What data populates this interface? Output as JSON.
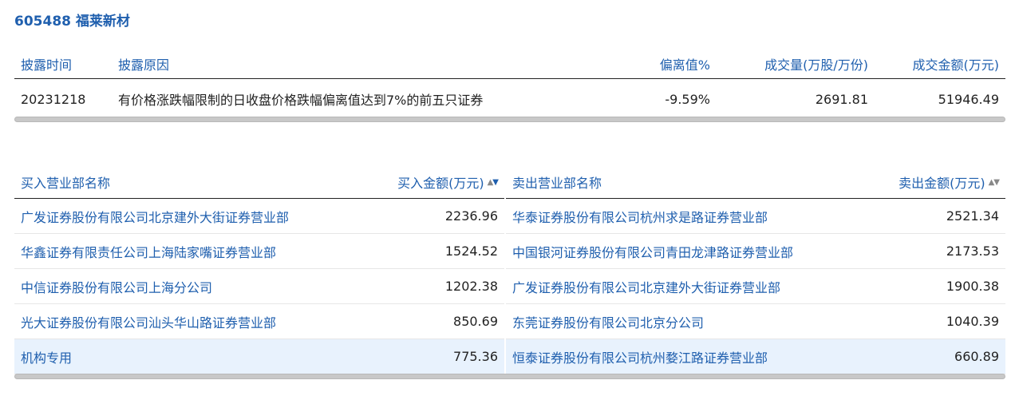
{
  "title": "605488 福莱新材",
  "disclosure": {
    "headers": {
      "date": "披露时间",
      "reason": "披露原因",
      "deviation": "偏离值%",
      "volume": "成交量(万股/万份)",
      "amount": "成交金额(万元)"
    },
    "row": {
      "date": "20231218",
      "reason": "有价格涨跌幅限制的日收盘价格跌幅偏离值达到7%的前五只证券",
      "deviation": "-9.59%",
      "volume": "2691.81",
      "amount": "51946.49"
    }
  },
  "buy": {
    "header_name": "买入营业部名称",
    "header_amount": "买入金额(万元)",
    "rows": [
      {
        "name": "广发证券股份有限公司北京建外大街证券营业部",
        "amount": "2236.96"
      },
      {
        "name": "华鑫证券有限责任公司上海陆家嘴证券营业部",
        "amount": "1524.52"
      },
      {
        "name": "中信证券股份有限公司上海分公司",
        "amount": "1202.38"
      },
      {
        "name": "光大证券股份有限公司汕头华山路证券营业部",
        "amount": "850.69"
      },
      {
        "name": "机构专用",
        "amount": "775.36"
      }
    ]
  },
  "sell": {
    "header_name": "卖出营业部名称",
    "header_amount": "卖出金额(万元)",
    "rows": [
      {
        "name": "华泰证券股份有限公司杭州求是路证券营业部",
        "amount": "2521.34"
      },
      {
        "name": "中国银河证券股份有限公司青田龙津路证券营业部",
        "amount": "2173.53"
      },
      {
        "name": "广发证券股份有限公司北京建外大街证券营业部",
        "amount": "1900.38"
      },
      {
        "name": "东莞证券股份有限公司北京分公司",
        "amount": "1040.39"
      },
      {
        "name": "恒泰证券股份有限公司杭州婺江路证券营业部",
        "amount": "660.89"
      }
    ]
  },
  "icons": {
    "sort": "sort-triangle-icon"
  },
  "colors": {
    "link": "#1f5fae",
    "highlight_row": "#e8f2fd"
  }
}
